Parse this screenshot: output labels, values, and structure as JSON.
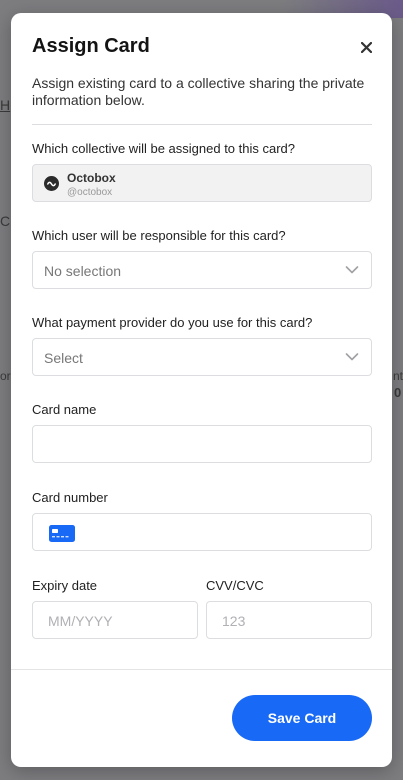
{
  "background": {
    "fragments": [
      "H",
      "C",
      "or",
      "nt",
      "0"
    ]
  },
  "modal": {
    "title": "Assign Card",
    "close_icon": "close-icon",
    "description": "Assign existing card to a collective sharing the private information below."
  },
  "collective": {
    "label": "Which collective will be assigned to this card?",
    "name": "Octobox",
    "handle": "@octobox"
  },
  "user": {
    "label": "Which user will be responsible for this card?",
    "value": "No selection"
  },
  "provider": {
    "label": "What payment provider do you use for this card?",
    "value": "Select"
  },
  "card_name": {
    "label": "Card name",
    "value": ""
  },
  "card_number": {
    "label": "Card number",
    "value": "",
    "icon": "credit-card-icon"
  },
  "expiry": {
    "label": "Expiry date",
    "placeholder": "MM/YYYY"
  },
  "cvv": {
    "label": "CVV/CVC",
    "placeholder": "123"
  },
  "footer": {
    "save_label": "Save Card"
  },
  "colors": {
    "accent": "#1869f5",
    "card_icon": "#1869f5"
  }
}
